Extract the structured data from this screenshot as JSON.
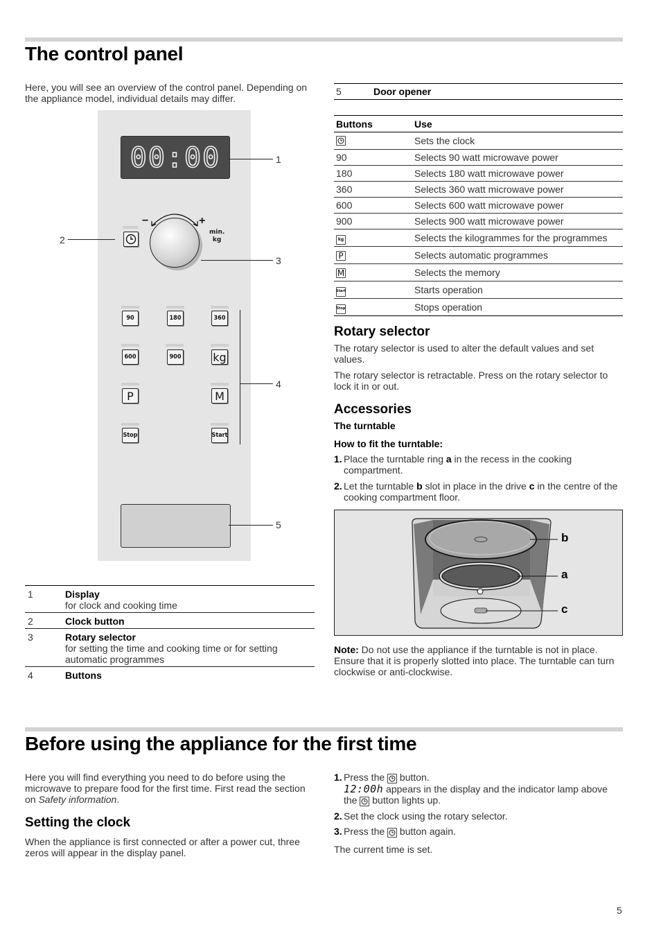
{
  "section1": {
    "title": "The control panel",
    "intro": "Here, you will see an overview of the control panel. Depending on the appliance model, individual details may differ.",
    "figure": {
      "display_text": "00:00",
      "knob_minus": "−",
      "knob_plus": "+",
      "knob_label_line1": "min.",
      "knob_label_line2": "kg",
      "buttons": [
        "90",
        "180",
        "360",
        "600",
        "900",
        "kg",
        "P",
        "M",
        "Stop",
        "Start"
      ],
      "callouts": [
        "1",
        "2",
        "3",
        "4",
        "5"
      ]
    },
    "legend": [
      {
        "num": "1",
        "title": "Display",
        "desc": "for clock and cooking time"
      },
      {
        "num": "2",
        "title": "Clock button",
        "desc": ""
      },
      {
        "num": "3",
        "title": "Rotary selector",
        "desc": "for setting the time and cooking time or for setting automatic programmes"
      },
      {
        "num": "4",
        "title": "Buttons",
        "desc": ""
      }
    ],
    "legend_continued": {
      "num": "5",
      "title": "Door opener"
    },
    "buttons_table": {
      "headers": [
        "Buttons",
        "Use"
      ],
      "rows": [
        {
          "button": "clock-icon",
          "use": "Sets the clock"
        },
        {
          "button": "90",
          "use": "Selects 90 watt microwave power"
        },
        {
          "button": "180",
          "use": "Selects 180 watt microwave power"
        },
        {
          "button": "360",
          "use": "Selects 360 watt microwave power"
        },
        {
          "button": "600",
          "use": "Selects 600 watt microwave power"
        },
        {
          "button": "900",
          "use": "Selects 900 watt microwave power"
        },
        {
          "button": "kg",
          "use": "Selects the kilogrammes for the programmes"
        },
        {
          "button": "P",
          "use": "Selects automatic programmes"
        },
        {
          "button": "M",
          "use": "Selects the memory"
        },
        {
          "button": "Start",
          "use": "Starts operation"
        },
        {
          "button": "Stop",
          "use": "Stops operation"
        }
      ]
    },
    "rotary": {
      "heading": "Rotary selector",
      "p1": "The rotary selector is used to alter the default values and set values.",
      "p2": "The rotary selector is retractable. Press on the rotary selector to lock it in or out."
    },
    "accessories": {
      "heading": "Accessories",
      "sub": "The turntable",
      "howto": "How to fit the turntable:",
      "steps": [
        {
          "n": "1.",
          "pre": "Place the turntable ring ",
          "bold": "a",
          "post": " in the recess in the cooking compartment."
        },
        {
          "n": "2.",
          "pre": "Let the turntable ",
          "bold": "b",
          "mid": " slot in place in the drive ",
          "bold2": "c",
          "post": " in the centre of the cooking compartment floor."
        }
      ],
      "figure_labels": [
        "b",
        "a",
        "c"
      ],
      "note_label": "Note:",
      "note_text": " Do not use the appliance if the turntable is not in place. Ensure that it is properly slotted into place. The turntable can turn clockwise or anti-clockwise."
    }
  },
  "section2": {
    "title": "Before using the appliance for the first time",
    "intro_pre": "Here you will find everything you need to do before using the microwave to prepare food for the first time. First read the section on ",
    "intro_italic": "Safety information",
    "intro_post": ".",
    "clock": {
      "heading": "Setting the clock",
      "text": "When the appliance is first connected or after a power cut, three zeros will appear in the display panel."
    },
    "steps": [
      {
        "n": "1.",
        "pre": "Press the ",
        "post": " button."
      },
      {
        "n": "2.",
        "text": "Set the clock using the rotary selector."
      },
      {
        "n": "3.",
        "pre": "Press the ",
        "post": " button again."
      }
    ],
    "step1_detail_display": "12:00h",
    "step1_detail_mid": " appears in the display and the indicator lamp above the ",
    "step1_detail_post": " button lights up.",
    "result": "The current time is set."
  },
  "page_number": "5"
}
